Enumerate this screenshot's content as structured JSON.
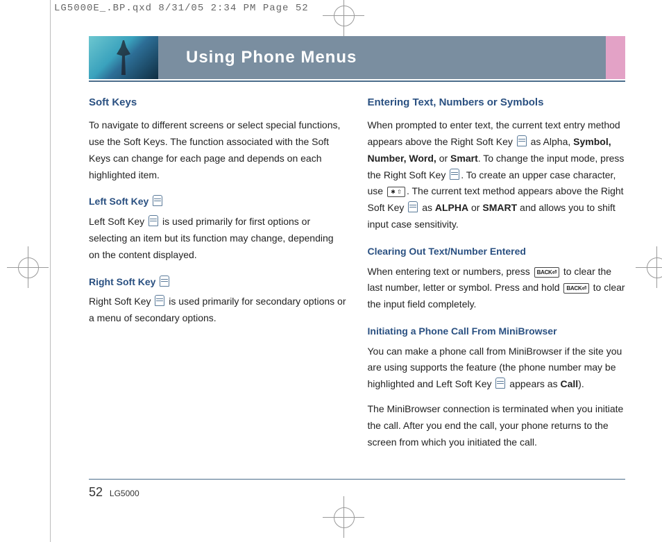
{
  "crop_info": "LG5000E_.BP.qxd  8/31/05  2:34 PM  Page 52",
  "header": {
    "title": "Using Phone Menus"
  },
  "left_col": {
    "h_softkeys": "Soft Keys",
    "p_softkeys": "To navigate to different screens or select special functions, use the Soft Keys. The function associated with the Soft Keys can change for each page and depends on each highlighted item.",
    "h_left": "Left Soft Key",
    "p_left_a": "Left Soft Key ",
    "p_left_b": " is used primarily for first options or selecting an item but its function may change, depending on the content displayed.",
    "h_right": "Right Soft Key",
    "p_right_a": "Right Soft Key ",
    "p_right_b": " is used primarily for secondary options or a menu of secondary options."
  },
  "right_col": {
    "h_enter": "Entering Text, Numbers or Symbols",
    "enter_1": "When prompted to enter text, the current text entry method appears above the Right Soft Key ",
    "enter_2": " as Alpha, ",
    "enter_bold_list": "Symbol, Number, Word,",
    "enter_or": " or ",
    "enter_smart": "Smart",
    "enter_3": ". To change the input mode, press the Right Soft Key ",
    "enter_4": ". To create an upper case character, use ",
    "enter_5": ". The current text method appears above the Right Soft Key ",
    "enter_6": " as ",
    "enter_alpha": "ALPHA",
    "enter_7": " or ",
    "enter_smart2": "SMART",
    "enter_8": " and allows you to shift input case sensitivity.",
    "h_clear": "Clearing Out Text/Number Entered",
    "clear_1": "When entering text or numbers, press ",
    "clear_2": " to clear the last number, letter or symbol. Press and hold ",
    "clear_3": " to clear the input field completely.",
    "h_init": "Initiating a Phone Call From MiniBrowser",
    "init_1": "You can make a phone call from MiniBrowser if the site you are using supports the feature (the phone number may be highlighted and Left Soft Key ",
    "init_2": " appears as ",
    "init_call": "Call",
    "init_3": ").",
    "init_p2": "The MiniBrowser connection is terminated when you initiate the call. After you end the call, your phone returns to the screen from which you initiated the call."
  },
  "icons": {
    "back_label": "BACK⏎",
    "star_label": "✱ ⇧"
  },
  "footer": {
    "page": "52",
    "model": "LG5000"
  }
}
